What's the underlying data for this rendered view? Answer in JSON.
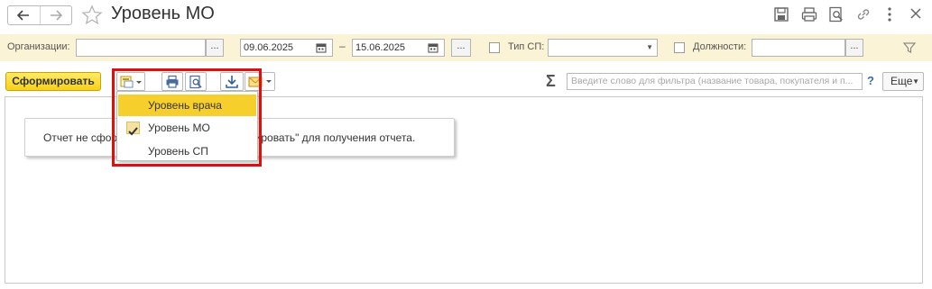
{
  "window": {
    "title": "Уровень МО"
  },
  "filters": {
    "organizations_label": "Организации:",
    "organizations_value": "",
    "ellipsis": "...",
    "date_from": "09.06.2025",
    "date_sep": "–",
    "date_to": "15.06.2025",
    "tip_sp_label": "Тип СП:",
    "tip_sp_value": "",
    "positions_label": "Должности:",
    "positions_value": ""
  },
  "toolbar": {
    "generate_label": "Сформировать",
    "search_placeholder": "Введите слово для фильтра (название товара, покупателя и п...",
    "help": "?",
    "more_label": "Еще"
  },
  "variant_menu": {
    "items": [
      {
        "label": "Уровень врача",
        "highlighted": true,
        "checked": false
      },
      {
        "label": "Уровень МО",
        "highlighted": false,
        "checked": true
      },
      {
        "label": "Уровень СП",
        "highlighted": false,
        "checked": false
      }
    ]
  },
  "report": {
    "notice_text": "Отчет не сформирован. Нажмите \"Сформировать\" для получения отчета."
  },
  "colors": {
    "accent_yellow": "#f7d117",
    "filter_bg": "#fbf3d5",
    "highlight_red": "#e10e0e"
  }
}
